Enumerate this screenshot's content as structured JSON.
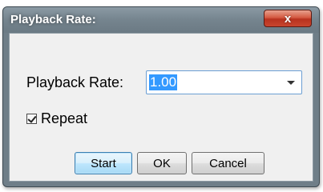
{
  "window": {
    "title": "Playback Rate:",
    "close_icon": "x-close-icon",
    "close_label": "x"
  },
  "form": {
    "rate_label": "Playback Rate:",
    "rate_value": "1.00",
    "rate_dropdown_icon": "chevron-down-icon",
    "repeat_label": "Repeat",
    "repeat_checked": true
  },
  "buttons": {
    "start_label": "Start",
    "ok_label": "OK",
    "cancel_label": "Cancel"
  },
  "colors": {
    "selection": "#3399ff",
    "close_button": "#c8452f",
    "default_button": "#bee6fd"
  }
}
